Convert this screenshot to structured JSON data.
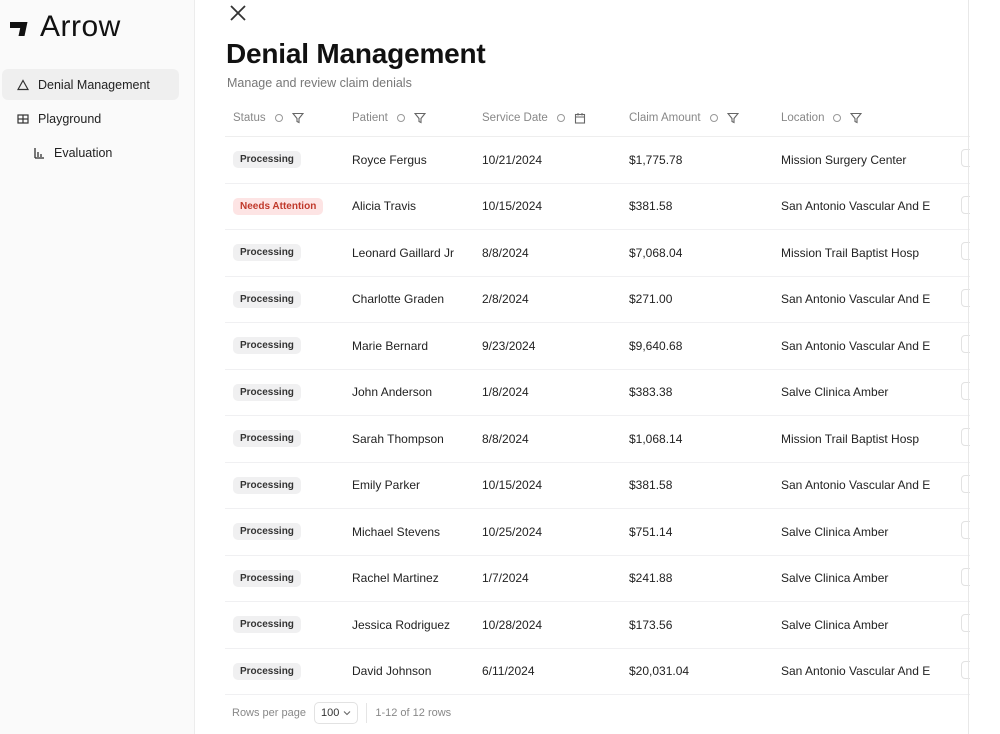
{
  "brand": {
    "name": "Arrow"
  },
  "sidebar": {
    "items": [
      {
        "label": "Denial Management",
        "icon": "triangle-icon",
        "active": true
      },
      {
        "label": "Playground",
        "icon": "grid-icon",
        "active": false
      },
      {
        "label": "Evaluation",
        "icon": "bar-chart-icon",
        "active": false
      }
    ]
  },
  "header": {
    "title": "Denial Management",
    "subtitle": "Manage and review claim denials"
  },
  "table": {
    "columns": [
      "Status",
      "Patient",
      "Service Date",
      "Claim Amount",
      "Location"
    ],
    "rows": [
      {
        "status": "Processing",
        "patient": "Royce Fergus",
        "date": "10/21/2024",
        "amount": "$1,775.78",
        "location": "Mission Surgery Center"
      },
      {
        "status": "Needs Attention",
        "patient": "Alicia Travis",
        "date": "10/15/2024",
        "amount": "$381.58",
        "location": "San Antonio Vascular And E"
      },
      {
        "status": "Processing",
        "patient": "Leonard Gaillard Jr",
        "date": "8/8/2024",
        "amount": "$7,068.04",
        "location": "Mission Trail Baptist Hosp"
      },
      {
        "status": "Processing",
        "patient": "Charlotte Graden",
        "date": "2/8/2024",
        "amount": "$271.00",
        "location": "San Antonio Vascular And E"
      },
      {
        "status": "Processing",
        "patient": "Marie Bernard",
        "date": "9/23/2024",
        "amount": "$9,640.68",
        "location": "San Antonio Vascular And E"
      },
      {
        "status": "Processing",
        "patient": "John Anderson",
        "date": "1/8/2024",
        "amount": "$383.38",
        "location": "Salve Clinica Amber"
      },
      {
        "status": "Processing",
        "patient": "Sarah Thompson",
        "date": "8/8/2024",
        "amount": "$1,068.14",
        "location": "Mission Trail Baptist Hosp"
      },
      {
        "status": "Processing",
        "patient": "Emily Parker",
        "date": "10/15/2024",
        "amount": "$381.58",
        "location": "San Antonio Vascular And E"
      },
      {
        "status": "Processing",
        "patient": "Michael Stevens",
        "date": "10/25/2024",
        "amount": "$751.14",
        "location": "Salve Clinica Amber"
      },
      {
        "status": "Processing",
        "patient": "Rachel Martinez",
        "date": "1/7/2024",
        "amount": "$241.88",
        "location": "Salve Clinica Amber"
      },
      {
        "status": "Processing",
        "patient": "Jessica Rodriguez",
        "date": "10/28/2024",
        "amount": "$173.56",
        "location": "Salve Clinica Amber"
      },
      {
        "status": "Processing",
        "patient": "David Johnson",
        "date": "6/11/2024",
        "amount": "$20,031.04",
        "location": "San Antonio Vascular And E"
      }
    ]
  },
  "footer": {
    "rows_per_page_label": "Rows per page",
    "rows_per_page_value": "100",
    "range_text": "1-12 of 12 rows"
  },
  "colors": {
    "badge_default_bg": "#f0f0f1",
    "badge_alert_bg": "#fde4e4",
    "badge_alert_text": "#c0392b",
    "sidebar_active_bg": "#efefef"
  }
}
